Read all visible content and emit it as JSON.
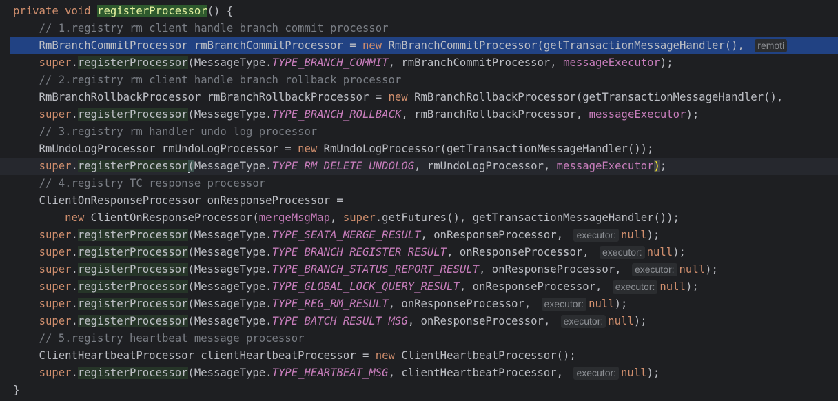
{
  "lines": [
    {
      "tokens": [
        [
          "kw",
          "private void "
        ],
        [
          "fn-decl",
          "registerProcessor"
        ],
        [
          "",
          "() {"
        ]
      ]
    },
    {
      "tokens": [
        [
          "",
          "    "
        ],
        [
          "cm",
          "// 1.registry rm client handle branch commit processor"
        ]
      ]
    },
    {
      "tokens": [
        [
          "",
          "    RmBranchCommitProcessor rmBranchCommitProcessor = "
        ],
        [
          "kw",
          "new "
        ],
        [
          "",
          "RmBranchCommitProcessor(getTransactionMessageHandler(), "
        ],
        [
          "hint",
          "remoti"
        ]
      ]
    },
    {
      "tokens": [
        [
          "",
          "    "
        ],
        [
          "kw",
          "super"
        ],
        [
          "",
          "."
        ],
        [
          "hl",
          "registerProcessor"
        ],
        [
          "",
          "(MessageType."
        ],
        [
          "cst",
          "TYPE_BRANCH_COMMIT"
        ],
        [
          "",
          ", rmBranchCommitProcessor, "
        ],
        [
          "fld",
          "messageExecutor"
        ],
        [
          "",
          ");"
        ]
      ]
    },
    {
      "tokens": [
        [
          "",
          "    "
        ],
        [
          "cm",
          "// 2.registry rm client handle branch rollback processor"
        ]
      ]
    },
    {
      "tokens": [
        [
          "",
          "    RmBranchRollbackProcessor rmBranchRollbackProcessor = "
        ],
        [
          "kw",
          "new "
        ],
        [
          "",
          "RmBranchRollbackProcessor(getTransactionMessageHandler(), "
        ]
      ]
    },
    {
      "tokens": [
        [
          "",
          "    "
        ],
        [
          "kw",
          "super"
        ],
        [
          "",
          "."
        ],
        [
          "hl",
          "registerProcessor"
        ],
        [
          "",
          "(MessageType."
        ],
        [
          "cst",
          "TYPE_BRANCH_ROLLBACK"
        ],
        [
          "",
          ", rmBranchRollbackProcessor, "
        ],
        [
          "fld",
          "messageExecutor"
        ],
        [
          "",
          ");"
        ]
      ]
    },
    {
      "tokens": [
        [
          "",
          "    "
        ],
        [
          "cm",
          "// 3.registry rm handler undo log processor"
        ]
      ]
    },
    {
      "tokens": [
        [
          "",
          "    RmUndoLogProcessor rmUndoLogProcessor = "
        ],
        [
          "kw",
          "new "
        ],
        [
          "",
          "RmUndoLogProcessor(getTransactionMessageHandler());"
        ]
      ]
    },
    {
      "tokens": [
        [
          "",
          "    "
        ],
        [
          "kw",
          "super"
        ],
        [
          "",
          "."
        ],
        [
          "hl",
          "registerProcessor"
        ],
        [
          "caret-bar",
          ""
        ],
        [
          "brace-match",
          "("
        ],
        [
          "",
          "MessageType."
        ],
        [
          "cst",
          "TYPE_RM_DELETE_UNDOLOG"
        ],
        [
          "",
          ", rmUndoLogProcessor, "
        ],
        [
          "fld",
          "messageExecutor"
        ],
        [
          "paren-hl",
          ")"
        ],
        [
          "",
          ";"
        ]
      ]
    },
    {
      "tokens": [
        [
          "",
          "    "
        ],
        [
          "cm",
          "// 4.registry TC response processor"
        ]
      ]
    },
    {
      "tokens": [
        [
          "",
          "    ClientOnResponseProcessor onResponseProcessor ="
        ]
      ]
    },
    {
      "tokens": [
        [
          "",
          "        "
        ],
        [
          "kw",
          "new "
        ],
        [
          "",
          "ClientOnResponseProcessor("
        ],
        [
          "fld",
          "mergeMsgMap"
        ],
        [
          "",
          ", "
        ],
        [
          "kw",
          "super"
        ],
        [
          "",
          ".getFutures(), getTransactionMessageHandler());"
        ]
      ]
    },
    {
      "tokens": [
        [
          "",
          "    "
        ],
        [
          "kw",
          "super"
        ],
        [
          "",
          "."
        ],
        [
          "hl",
          "registerProcessor"
        ],
        [
          "",
          "(MessageType."
        ],
        [
          "cst",
          "TYPE_SEATA_MERGE_RESULT"
        ],
        [
          "",
          ", onResponseProcessor, "
        ],
        [
          "hint",
          "executor:"
        ],
        [
          "kw",
          "null"
        ],
        [
          "",
          ");"
        ]
      ]
    },
    {
      "tokens": [
        [
          "",
          "    "
        ],
        [
          "kw",
          "super"
        ],
        [
          "",
          "."
        ],
        [
          "hl",
          "registerProcessor"
        ],
        [
          "",
          "(MessageType."
        ],
        [
          "cst",
          "TYPE_BRANCH_REGISTER_RESULT"
        ],
        [
          "",
          ", onResponseProcessor, "
        ],
        [
          "hint",
          "executor:"
        ],
        [
          "kw",
          "null"
        ],
        [
          "",
          ");"
        ]
      ]
    },
    {
      "tokens": [
        [
          "",
          "    "
        ],
        [
          "kw",
          "super"
        ],
        [
          "",
          "."
        ],
        [
          "hl",
          "registerProcessor"
        ],
        [
          "",
          "(MessageType."
        ],
        [
          "cst",
          "TYPE_BRANCH_STATUS_REPORT_RESULT"
        ],
        [
          "",
          ", onResponseProcessor, "
        ],
        [
          "hint",
          "executor:"
        ],
        [
          "kw",
          "null"
        ],
        [
          "",
          ");"
        ]
      ]
    },
    {
      "tokens": [
        [
          "",
          "    "
        ],
        [
          "kw",
          "super"
        ],
        [
          "",
          "."
        ],
        [
          "hl",
          "registerProcessor"
        ],
        [
          "",
          "(MessageType."
        ],
        [
          "cst",
          "TYPE_GLOBAL_LOCK_QUERY_RESULT"
        ],
        [
          "",
          ", onResponseProcessor, "
        ],
        [
          "hint",
          "executor:"
        ],
        [
          "kw",
          "null"
        ],
        [
          "",
          ");"
        ]
      ]
    },
    {
      "tokens": [
        [
          "",
          "    "
        ],
        [
          "kw",
          "super"
        ],
        [
          "",
          "."
        ],
        [
          "hl",
          "registerProcessor"
        ],
        [
          "",
          "(MessageType."
        ],
        [
          "cst",
          "TYPE_REG_RM_RESULT"
        ],
        [
          "",
          ", onResponseProcessor, "
        ],
        [
          "hint",
          "executor:"
        ],
        [
          "kw",
          "null"
        ],
        [
          "",
          ");"
        ]
      ]
    },
    {
      "tokens": [
        [
          "",
          "    "
        ],
        [
          "kw",
          "super"
        ],
        [
          "",
          "."
        ],
        [
          "hl",
          "registerProcessor"
        ],
        [
          "",
          "(MessageType."
        ],
        [
          "cst",
          "TYPE_BATCH_RESULT_MSG"
        ],
        [
          "",
          ", onResponseProcessor, "
        ],
        [
          "hint",
          "executor:"
        ],
        [
          "kw",
          "null"
        ],
        [
          "",
          ");"
        ]
      ]
    },
    {
      "tokens": [
        [
          "",
          "    "
        ],
        [
          "cm",
          "// 5.registry heartbeat message processor"
        ]
      ]
    },
    {
      "tokens": [
        [
          "",
          "    ClientHeartbeatProcessor clientHeartbeatProcessor = "
        ],
        [
          "kw",
          "new "
        ],
        [
          "",
          "ClientHeartbeatProcessor();"
        ]
      ]
    },
    {
      "tokens": [
        [
          "",
          "    "
        ],
        [
          "kw",
          "super"
        ],
        [
          "",
          "."
        ],
        [
          "hl",
          "registerProcessor"
        ],
        [
          "",
          "(MessageType."
        ],
        [
          "cst",
          "TYPE_HEARTBEAT_MSG"
        ],
        [
          "",
          ", clientHeartbeatProcessor, "
        ],
        [
          "hint",
          "executor:"
        ],
        [
          "kw",
          "null"
        ],
        [
          "",
          ");"
        ]
      ]
    },
    {
      "tokens": [
        [
          "",
          "}"
        ]
      ]
    }
  ],
  "selected_line": 2,
  "caret_line": 9
}
